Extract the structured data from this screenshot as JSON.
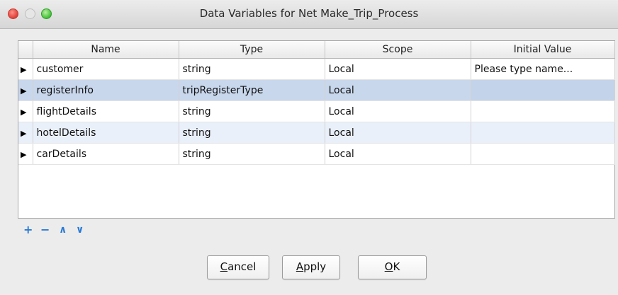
{
  "window": {
    "title": "Data Variables for Net Make_Trip_Process"
  },
  "table": {
    "columns": [
      "Name",
      "Type",
      "Scope",
      "Initial Value"
    ],
    "rows": [
      {
        "name": "customer",
        "type": "string",
        "scope": "Local",
        "initial": "Please type name..."
      },
      {
        "name": "registerInfo",
        "type": "tripRegisterType",
        "scope": "Local",
        "initial": ""
      },
      {
        "name": "flightDetails",
        "type": "string",
        "scope": "Local",
        "initial": ""
      },
      {
        "name": "hotelDetails",
        "type": "string",
        "scope": "Local",
        "initial": ""
      },
      {
        "name": "carDetails",
        "type": "string",
        "scope": "Local",
        "initial": ""
      }
    ],
    "selected_row": 1
  },
  "toolbar": {
    "add": "+",
    "remove": "−",
    "up": "∧",
    "down": "∨"
  },
  "buttons": {
    "cancel": "Cancel",
    "apply": "Apply",
    "ok": "OK"
  },
  "icons": {
    "row_expander": "triangle-right-icon"
  },
  "colors": {
    "accent": "#2b7bd6",
    "selection": "#c8d7ec",
    "close": "#e0443e",
    "zoom": "#48c33c"
  }
}
